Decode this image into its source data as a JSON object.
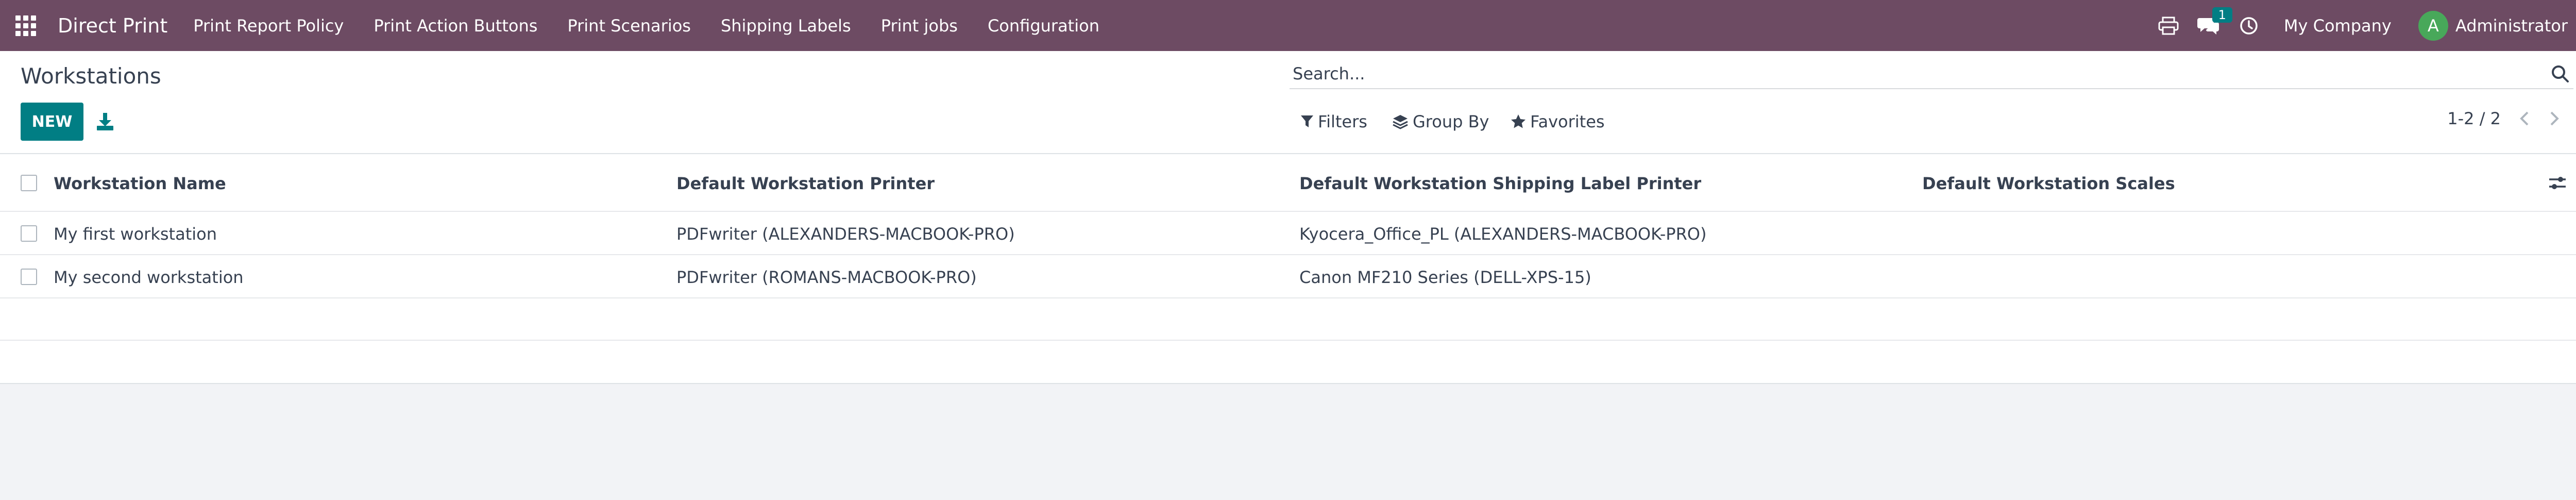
{
  "navbar": {
    "app_title": "Direct Print",
    "menu": [
      "Print Report Policy",
      "Print Action Buttons",
      "Print Scenarios",
      "Shipping Labels",
      "Print jobs",
      "Configuration"
    ],
    "messages_badge": "1",
    "company": "My Company",
    "user_initial": "A",
    "user_name": "Administrator",
    "icons": [
      "apps-grid-icon",
      "printer-icon",
      "chat-icon",
      "clock-icon"
    ],
    "colors": {
      "navbar_bg": "#6d4b63",
      "avatar_bg": "#48a85a",
      "badge_bg": "#017e84"
    }
  },
  "control_panel": {
    "page_title": "Workstations",
    "new_label": "NEW",
    "search_placeholder": "Search...",
    "filters_label": "Filters",
    "group_by_label": "Group By",
    "favorites_label": "Favorites",
    "pager_text": "1-2 / 2",
    "colors": {
      "primary": "#017e84"
    }
  },
  "table": {
    "columns": [
      "Workstation Name",
      "Default Workstation Printer",
      "Default Workstation Shipping Label Printer",
      "Default Workstation Scales"
    ],
    "rows": [
      {
        "name": "My first workstation",
        "printer": "PDFwriter (ALEXANDERS-MACBOOK-PRO)",
        "shipping_printer": "Kyocera_Office_PL (ALEXANDERS-MACBOOK-PRO)",
        "scales": ""
      },
      {
        "name": "My second workstation",
        "printer": "PDFwriter (ROMANS-MACBOOK-PRO)",
        "shipping_printer": "Canon MF210 Series (DELL-XPS-15)",
        "scales": ""
      }
    ]
  }
}
